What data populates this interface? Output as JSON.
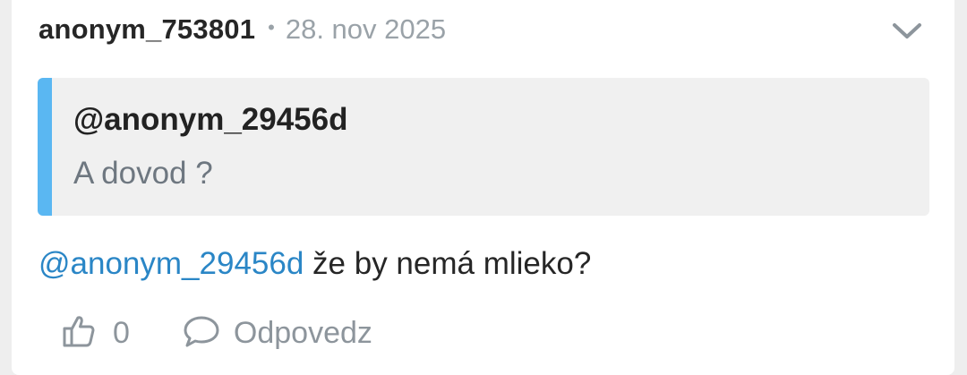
{
  "comment": {
    "username": "anonym_753801",
    "separator": "•",
    "date": "28. nov 2025",
    "menu_icon": "chevron-down-icon",
    "quote": {
      "author": "@anonym_29456d",
      "text": "A dovod ?",
      "accent_color": "#5ab7f2"
    },
    "body": {
      "mention": "@anonym_29456d",
      "text": " že by nemá mlieko?"
    },
    "actions": {
      "like_icon": "thumbs-up-icon",
      "like_count": "0",
      "reply_icon": "speech-bubble-icon",
      "reply_label": "Odpovedz"
    }
  },
  "colors": {
    "mention": "#2a86c6",
    "muted": "#9aa2a8",
    "text": "#262626"
  }
}
